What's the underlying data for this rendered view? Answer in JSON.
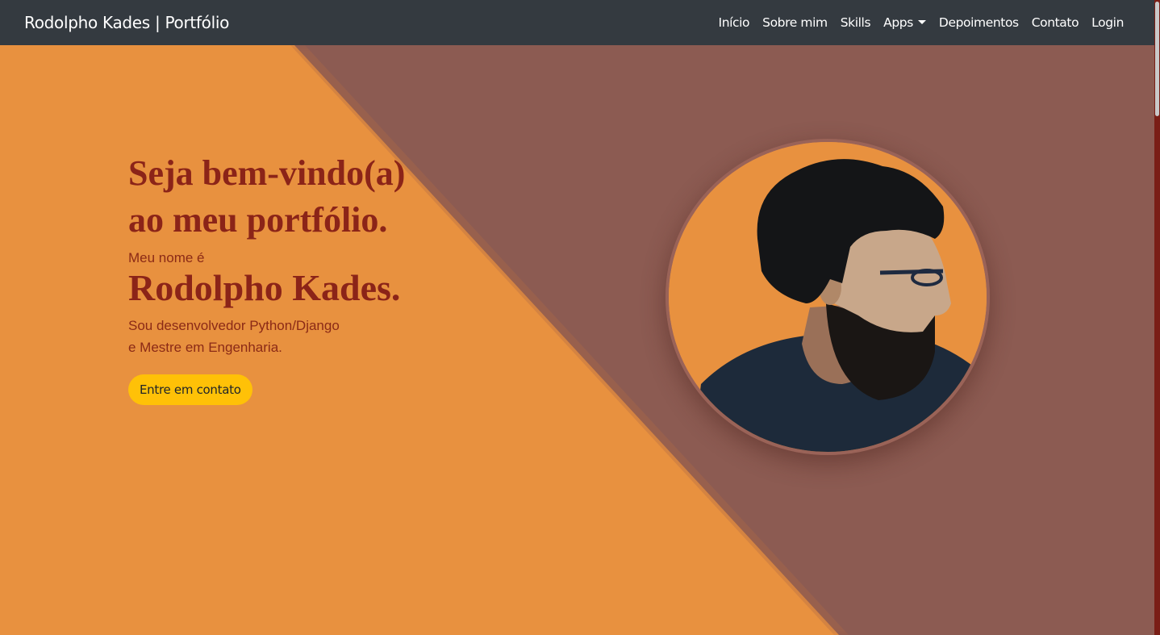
{
  "nav": {
    "brand": "Rodolpho Kades | Portfólio",
    "links": [
      "Início",
      "Sobre mim",
      "Skills",
      "Apps",
      "Depoimentos",
      "Contato",
      "Login"
    ]
  },
  "hero": {
    "welcome_line1": "Seja bem-vindo(a)",
    "welcome_line2": "ao meu portfólio.",
    "name_intro": "Meu nome é",
    "name": "Rodolpho Kades.",
    "desc_line1": "Sou desenvolvedor Python/Django",
    "desc_line2": "e Mestre em Engenharia.",
    "cta": "Entre em contato"
  },
  "colors": {
    "navbar": "#343a40",
    "orange": "#e8913f",
    "brown": "#8c5b52",
    "heading": "#8b2418",
    "button": "#ffc107"
  }
}
